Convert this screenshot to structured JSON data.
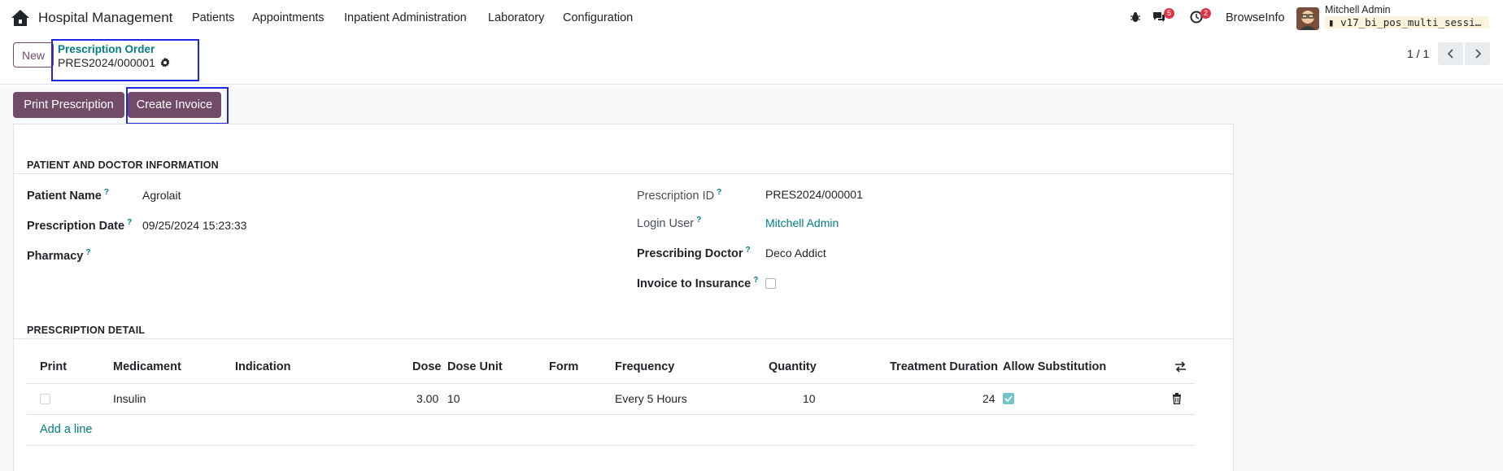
{
  "navbar": {
    "app_title": "Hospital Management",
    "menu": [
      "Patients",
      "Appointments",
      "Inpatient Administration",
      "Laboratory",
      "Configuration"
    ],
    "messages_count": "5",
    "activities_count": "2",
    "company": "BrowseInfo",
    "user_name": "Mitchell Admin",
    "database": "v17_bi_pos_multi_session…"
  },
  "control_panel": {
    "new_label": "New",
    "breadcrumb_parent": "Prescription Order",
    "breadcrumb_current": "PRES2024/000001",
    "pager": "1 / 1"
  },
  "actions": {
    "print": "Print Prescription",
    "invoice": "Create Invoice"
  },
  "sections": {
    "patient_doctor": "PATIENT AND DOCTOR INFORMATION",
    "detail": "PRESCRIPTION DETAIL"
  },
  "fields_left": {
    "patient_name_label": "Patient Name",
    "patient_name": "Agrolait",
    "date_label": "Prescription Date",
    "date": "09/25/2024 15:23:33",
    "pharmacy_label": "Pharmacy",
    "pharmacy": ""
  },
  "fields_right": {
    "prescription_id_label": "Prescription ID",
    "prescription_id": "PRES2024/000001",
    "login_user_label": "Login User",
    "login_user": "Mitchell Admin",
    "doctor_label": "Prescribing Doctor",
    "doctor": "Deco Addict",
    "insurance_label": "Invoice to Insurance",
    "insurance_checked": false
  },
  "table": {
    "headers": {
      "print": "Print",
      "medicament": "Medicament",
      "indication": "Indication",
      "dose": "Dose",
      "dose_unit": "Dose Unit",
      "form": "Form",
      "frequency": "Frequency",
      "quantity": "Quantity",
      "duration": "Treatment Duration",
      "substitution": "Allow Substitution"
    },
    "rows": [
      {
        "print": false,
        "medicament": "Insulin",
        "indication": "",
        "dose": "3.00",
        "dose_unit": "10",
        "form": "",
        "frequency": "Every 5 Hours",
        "quantity": "10",
        "duration": "24",
        "substitution": true
      }
    ],
    "add_line": "Add a line"
  },
  "colors": {
    "primary": "#714b67",
    "link": "#017e84",
    "highlight": "#1f27e6"
  }
}
